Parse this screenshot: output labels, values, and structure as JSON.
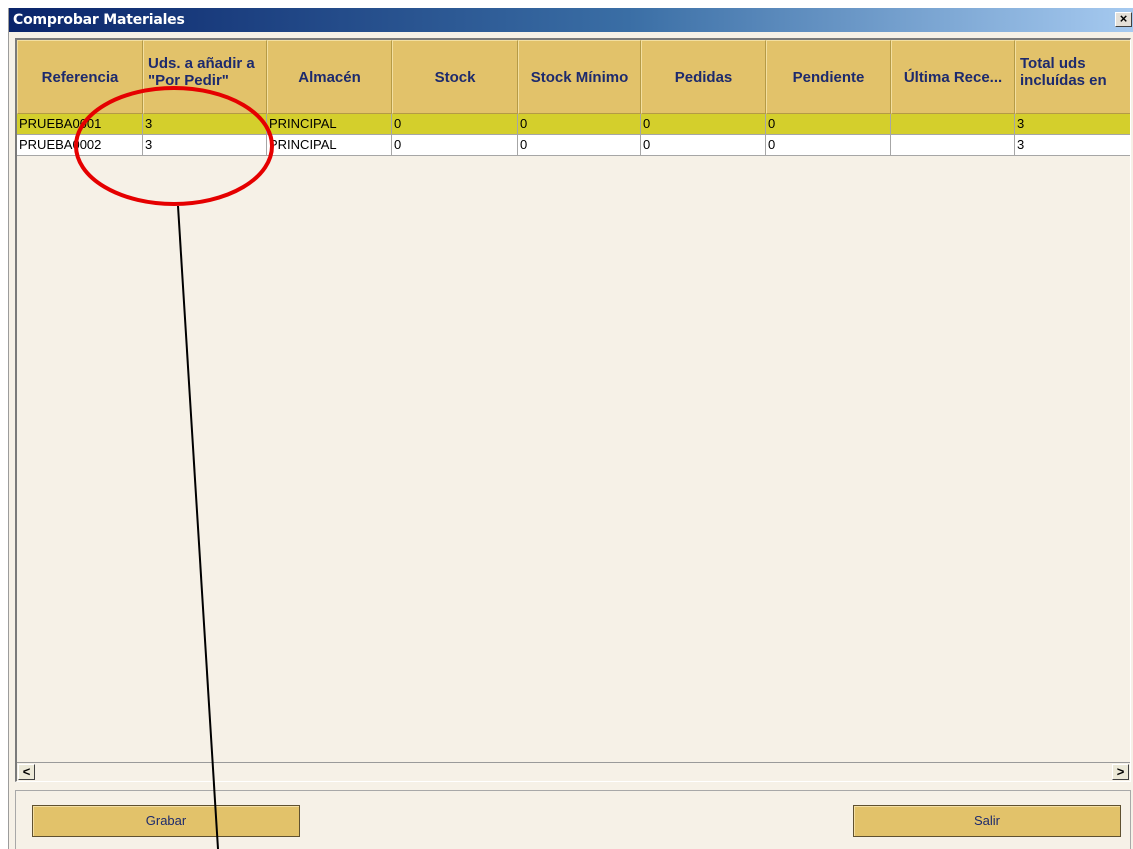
{
  "window": {
    "title": "Comprobar Materiales",
    "close_label": "×"
  },
  "table": {
    "columns": [
      "Referencia",
      "Uds. a añadir a \"Por Pedir\"",
      "Almacén",
      "Stock",
      "Stock Mínimo",
      "Pedidas",
      "Pendiente",
      "Última Rece...",
      "Total uds incluídas en"
    ],
    "rows": [
      [
        "PRUEBA0001",
        "3",
        "PRINCIPAL",
        "0",
        "0",
        "0",
        "0",
        "",
        "3"
      ],
      [
        "PRUEBA0002",
        "3",
        "PRINCIPAL",
        "0",
        "0",
        "0",
        "0",
        "",
        "3"
      ]
    ],
    "selected_row": 0
  },
  "scrollbar": {
    "left_arrow": "<",
    "right_arrow": ">"
  },
  "buttons": {
    "grabar_label": "Grabar",
    "salir_label": "Salir"
  },
  "colors": {
    "header": "#e2c26a",
    "selected_row": "#d4cf2c",
    "annotation_circle": "#e50000"
  }
}
